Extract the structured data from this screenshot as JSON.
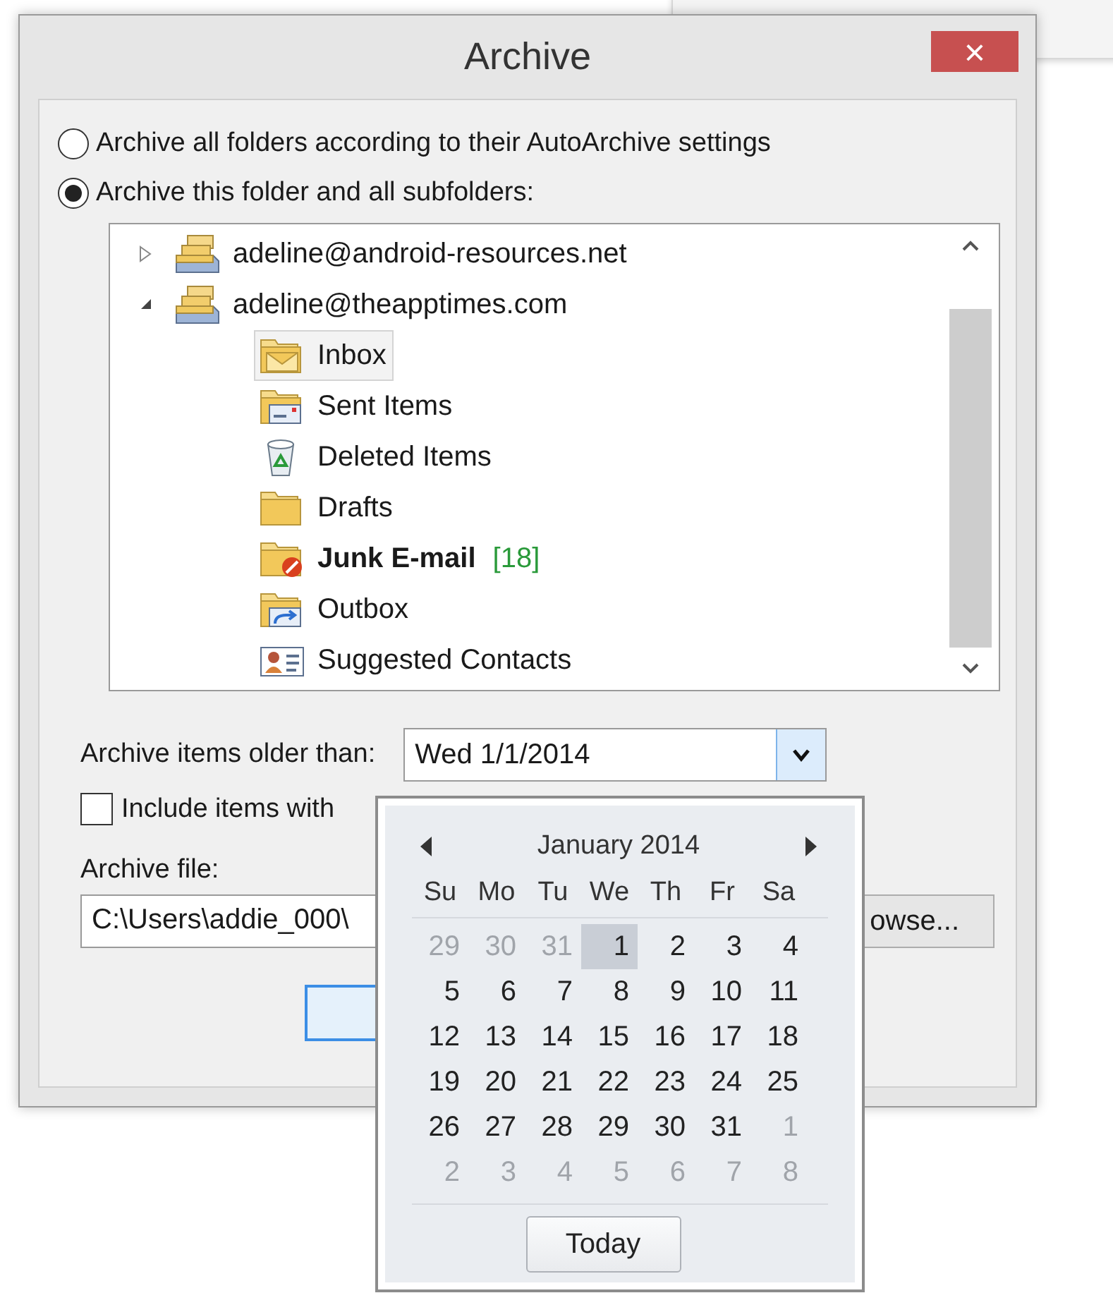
{
  "window": {
    "title": "Archive",
    "close": "×"
  },
  "options": [
    {
      "label": "Archive all folders according to their AutoArchive settings",
      "selected": false
    },
    {
      "label": "Archive this folder and all subfolders:",
      "selected": true
    }
  ],
  "tree": [
    {
      "label": "adeline@android-resources.net",
      "kind": "account",
      "expanded": false,
      "selected": false
    },
    {
      "label": "adeline@theapptimes.com",
      "kind": "account",
      "expanded": true,
      "selected": false,
      "children": [
        {
          "label": "Inbox",
          "kind": "inbox",
          "selected": true
        },
        {
          "label": "Sent Items",
          "kind": "sent",
          "selected": false
        },
        {
          "label": "Deleted Items",
          "kind": "deleted",
          "selected": false
        },
        {
          "label": "Drafts",
          "kind": "drafts",
          "selected": false
        },
        {
          "label": "Junk E-mail",
          "kind": "junk",
          "selected": false,
          "bold": true,
          "count": "[18]"
        },
        {
          "label": "Outbox",
          "kind": "outbox",
          "selected": false
        },
        {
          "label": "Suggested Contacts",
          "kind": "contacts",
          "selected": false
        }
      ]
    }
  ],
  "older_than": {
    "label": "Archive items older than:",
    "value": "Wed 1/1/2014"
  },
  "include": {
    "label": "Include items with",
    "checked": false
  },
  "archive_file": {
    "label": "Archive file:",
    "value": "C:\\Users\\addie_000\\",
    "browse": "owse..."
  },
  "calendar": {
    "month": "January 2014",
    "weekdays": [
      "Su",
      "Mo",
      "Tu",
      "We",
      "Th",
      "Fr",
      "Sa"
    ],
    "weeks": [
      [
        {
          "label": "29",
          "muted": true,
          "selected": false
        },
        {
          "label": "30",
          "muted": true,
          "selected": false
        },
        {
          "label": "31",
          "muted": true,
          "selected": false
        },
        {
          "label": "1",
          "muted": false,
          "selected": true
        },
        {
          "label": "2",
          "muted": false,
          "selected": false
        },
        {
          "label": "3",
          "muted": false,
          "selected": false
        },
        {
          "label": "4",
          "muted": false,
          "selected": false
        }
      ],
      [
        {
          "label": "5",
          "muted": false,
          "selected": false
        },
        {
          "label": "6",
          "muted": false,
          "selected": false
        },
        {
          "label": "7",
          "muted": false,
          "selected": false
        },
        {
          "label": "8",
          "muted": false,
          "selected": false
        },
        {
          "label": "9",
          "muted": false,
          "selected": false
        },
        {
          "label": "10",
          "muted": false,
          "selected": false
        },
        {
          "label": "11",
          "muted": false,
          "selected": false
        }
      ],
      [
        {
          "label": "12",
          "muted": false,
          "selected": false
        },
        {
          "label": "13",
          "muted": false,
          "selected": false
        },
        {
          "label": "14",
          "muted": false,
          "selected": false
        },
        {
          "label": "15",
          "muted": false,
          "selected": false
        },
        {
          "label": "16",
          "muted": false,
          "selected": false
        },
        {
          "label": "17",
          "muted": false,
          "selected": false
        },
        {
          "label": "18",
          "muted": false,
          "selected": false
        }
      ],
      [
        {
          "label": "19",
          "muted": false,
          "selected": false
        },
        {
          "label": "20",
          "muted": false,
          "selected": false
        },
        {
          "label": "21",
          "muted": false,
          "selected": false
        },
        {
          "label": "22",
          "muted": false,
          "selected": false
        },
        {
          "label": "23",
          "muted": false,
          "selected": false
        },
        {
          "label": "24",
          "muted": false,
          "selected": false
        },
        {
          "label": "25",
          "muted": false,
          "selected": false
        }
      ],
      [
        {
          "label": "26",
          "muted": false,
          "selected": false
        },
        {
          "label": "27",
          "muted": false,
          "selected": false
        },
        {
          "label": "28",
          "muted": false,
          "selected": false
        },
        {
          "label": "29",
          "muted": false,
          "selected": false
        },
        {
          "label": "30",
          "muted": false,
          "selected": false
        },
        {
          "label": "31",
          "muted": false,
          "selected": false
        },
        {
          "label": "1",
          "muted": true,
          "selected": false
        }
      ],
      [
        {
          "label": "2",
          "muted": true,
          "selected": false
        },
        {
          "label": "3",
          "muted": true,
          "selected": false
        },
        {
          "label": "4",
          "muted": true,
          "selected": false
        },
        {
          "label": "5",
          "muted": true,
          "selected": false
        },
        {
          "label": "6",
          "muted": true,
          "selected": false
        },
        {
          "label": "7",
          "muted": true,
          "selected": false
        },
        {
          "label": "8",
          "muted": true,
          "selected": false
        }
      ]
    ],
    "today": "Today"
  }
}
